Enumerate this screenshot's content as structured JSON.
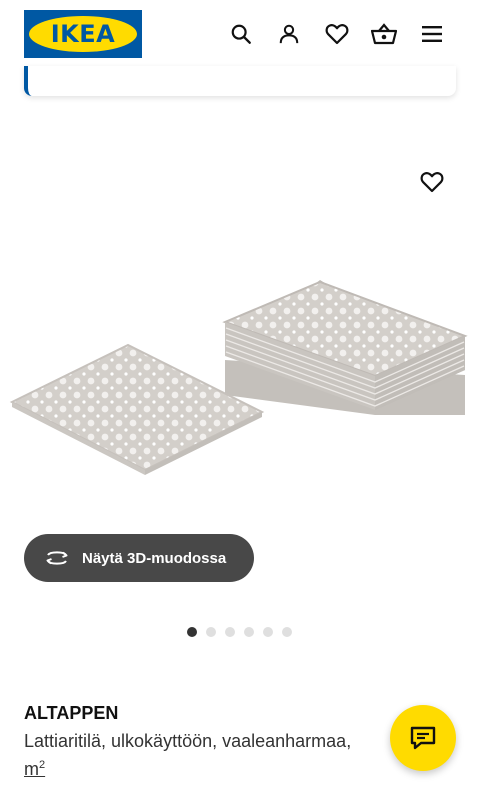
{
  "header": {
    "logo_text": "IKEA",
    "icons": [
      "search-icon",
      "account-icon",
      "heart-icon",
      "basket-icon",
      "menu-icon"
    ]
  },
  "colors": {
    "brand_blue": "#0058a3",
    "brand_yellow": "#ffdb00",
    "button_dark": "#484848"
  },
  "gallery": {
    "view_3d_label": "Näytä 3D-muodossa",
    "dot_count": 6,
    "active_index": 0
  },
  "product": {
    "name": "ALTAPPEN",
    "description": "Lattiaritilä, ulkokäyttöön, vaaleanharmaa,",
    "unit": "m",
    "unit_exp": "2"
  }
}
